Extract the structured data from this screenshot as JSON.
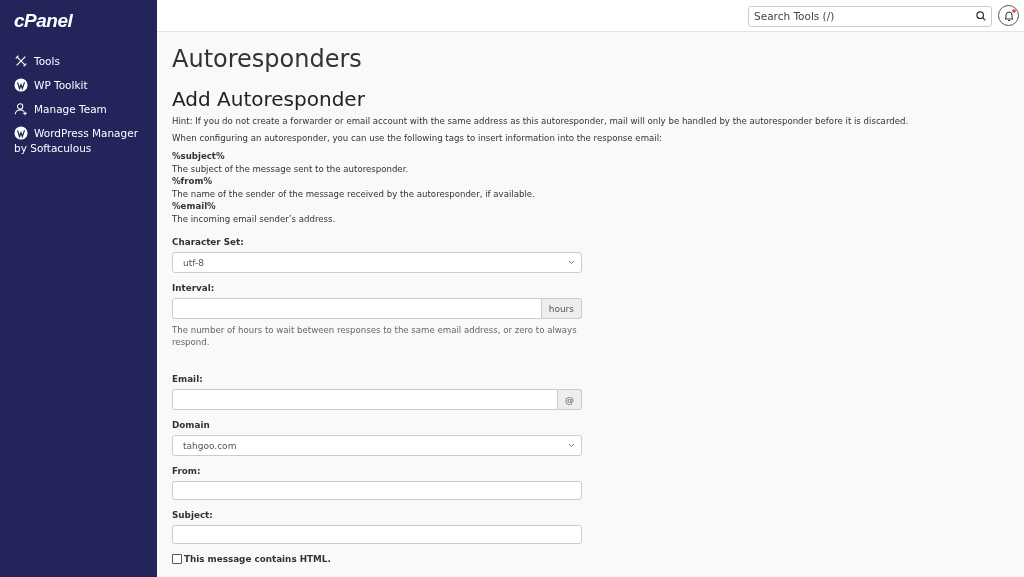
{
  "sidebar": {
    "logo": "cPanel",
    "items": [
      {
        "kind": "tools",
        "label": "Tools"
      },
      {
        "kind": "wordpress",
        "label": "WP Toolkit"
      },
      {
        "kind": "team",
        "label": "Manage Team"
      },
      {
        "kind": "wordpress",
        "label": "WordPress Manager by Softaculous"
      }
    ]
  },
  "header": {
    "search": {
      "placeholder": "Search Tools (/)"
    }
  },
  "page_title": "Autoresponders",
  "section_title": "Add Autoresponder",
  "hint": "Hint: If you do not create a forwarder or email account with the same address as this autoresponder, mail will only be handled by the autoresponder before it is discarded.",
  "tags_intro": "When configuring an autoresponder, you can use the following tags to insert information into the response email:",
  "tags": [
    {
      "tag": "%subject%",
      "description": "The subject of the message sent to the autoresponder."
    },
    {
      "tag": "%from%",
      "description": "The name of the sender of the message received by the autoresponder, if available."
    },
    {
      "tag": "%email%",
      "description": "The incoming email sender’s address."
    }
  ],
  "fields": [
    {
      "kind": "select",
      "label": "Character Set:",
      "value": "utf-8"
    },
    {
      "kind": "addon",
      "label": "Interval:",
      "addon": "hours",
      "help": "The number of hours to wait between responses to the same email address, or zero to always respond."
    },
    {
      "kind": "addon",
      "label": "Email:",
      "addon": "@"
    },
    {
      "kind": "select",
      "label": "Domain",
      "value": "tahgoo.com"
    },
    {
      "kind": "text",
      "label": "From:"
    },
    {
      "kind": "text",
      "label": "Subject:"
    },
    {
      "kind": "checkbox",
      "label": "This message contains HTML.",
      "checked": false
    }
  ]
}
